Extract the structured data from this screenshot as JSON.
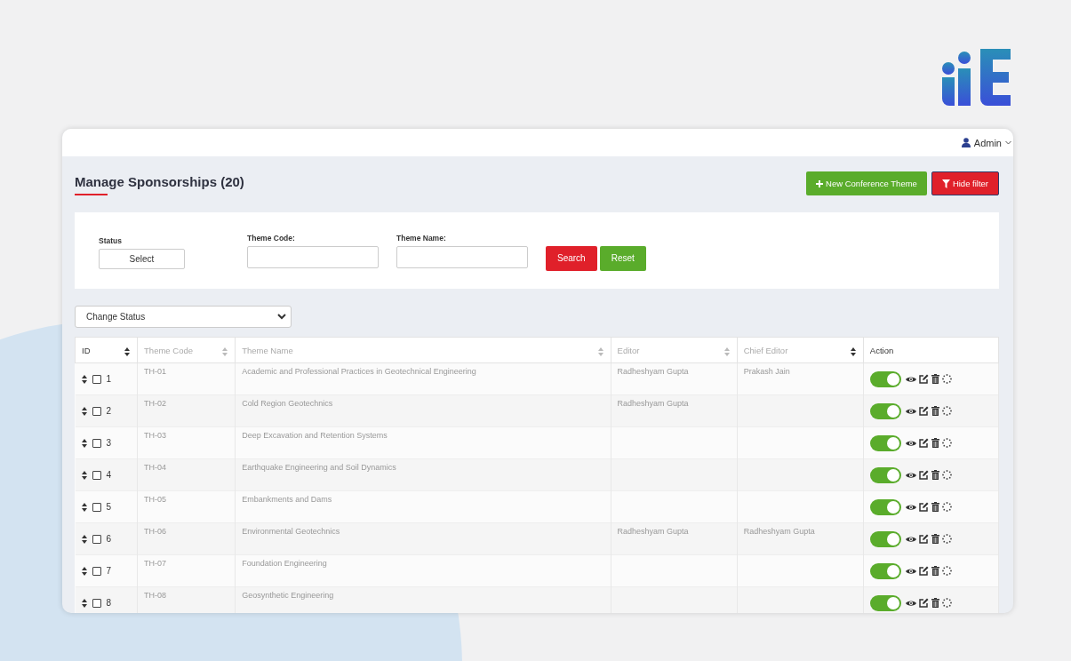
{
  "header": {
    "user": "Admin"
  },
  "page": {
    "title": "Manage Sponsorships (20)",
    "new_button": "New Conference Theme",
    "filter_button": "Hide filter"
  },
  "filters": [
    {
      "kind": "select",
      "label": "Status",
      "value": "Select"
    },
    {
      "kind": "text",
      "label": "Theme Code:"
    },
    {
      "kind": "text",
      "label": "Theme Name:"
    }
  ],
  "filter_actions": {
    "search": "Search",
    "reset": "Reset"
  },
  "bulk_action": {
    "value": "Change Status"
  },
  "table": {
    "columns": [
      "ID",
      "Theme Code",
      "Theme Name",
      "Editor",
      "Chief Editor",
      "Action"
    ],
    "rows": [
      {
        "checked": false,
        "id": "1",
        "code": "TH-01",
        "name": "Academic and Professional Practices in Geotechnical Engineering",
        "editor": "Radheshyam Gupta",
        "chief_editor": "Prakash Jain",
        "on": true
      },
      {
        "checked": false,
        "id": "2",
        "code": "TH-02",
        "name": "Cold Region Geotechnics",
        "editor": "Radheshyam Gupta",
        "on": true
      },
      {
        "checked": false,
        "id": "3",
        "code": "TH-03",
        "name": "Deep Excavation and Retention Systems",
        "on": true
      },
      {
        "checked": false,
        "id": "4",
        "code": "TH-04",
        "name": "Earthquake Engineering and Soil Dynamics",
        "on": true
      },
      {
        "checked": false,
        "id": "5",
        "code": "TH-05",
        "name": "Embankments and Dams",
        "on": true
      },
      {
        "checked": false,
        "id": "6",
        "code": "TH-06",
        "name": "Environmental Geotechnics",
        "editor": "Radheshyam Gupta",
        "chief_editor": "Radheshyam Gupta",
        "on": true
      },
      {
        "checked": false,
        "id": "7",
        "code": "TH-07",
        "name": "Foundation Engineering",
        "on": true
      },
      {
        "checked": false,
        "id": "8",
        "code": "TH-08",
        "name": "Geosynthetic Engineering",
        "on": true
      }
    ]
  }
}
